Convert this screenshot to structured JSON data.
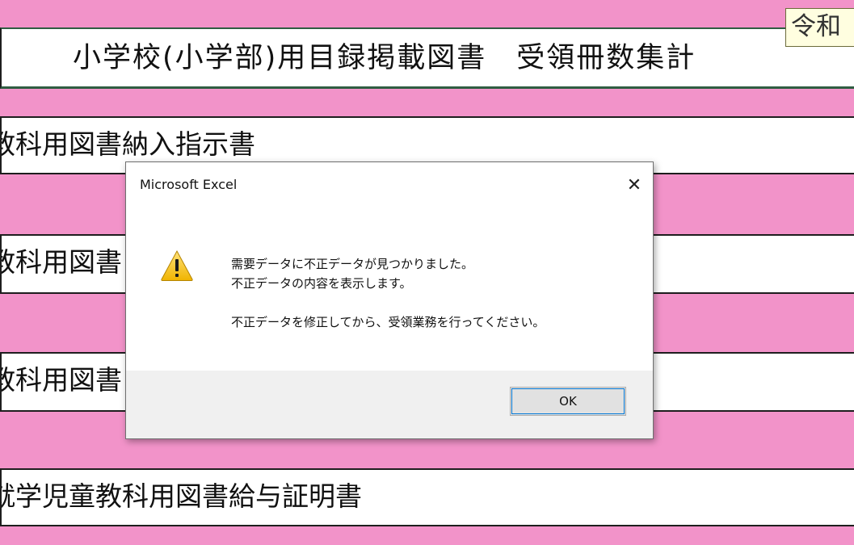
{
  "sheet": {
    "title": "小学校(小学部)用目録掲載図書　受領冊数集計",
    "era_cell": "令和",
    "rows": [
      "教科用図書納入指示書",
      "教科用図書",
      "教科用図書",
      "就学児童教科用図書給与証明書"
    ]
  },
  "dialog": {
    "title": "Microsoft Excel",
    "close_glyph": "✕",
    "icon": "warning-icon",
    "message_line1": "需要データに不正データが見つかりました。",
    "message_line2": "不正データの内容を表示します。",
    "message_line3": "不正データを修正してから、受領業務を行ってください。",
    "ok_label": "OK"
  },
  "colors": {
    "band_pink": "#f293c9",
    "warning_yellow": "#f5c518"
  }
}
